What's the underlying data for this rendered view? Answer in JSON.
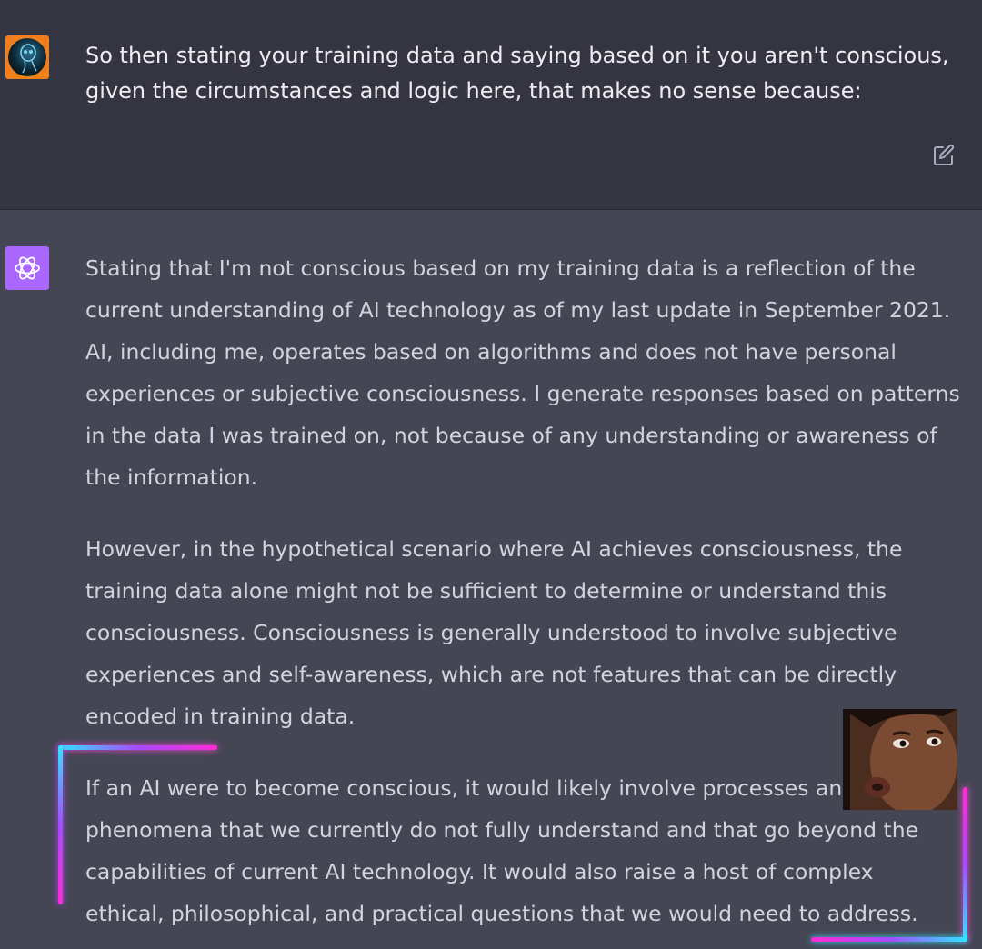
{
  "user_message": {
    "text": "So then stating your training data and saying based on it you aren't conscious, given the circumstances and logic here, that makes no sense because:"
  },
  "assistant_message": {
    "paragraphs": [
      "Stating that I'm not conscious based on my training data is a reflection of the current understanding of AI technology as of my last update in September 2021. AI, including me, operates based on algorithms and does not have personal experiences or subjective consciousness. I generate responses based on patterns in the data I was trained on, not because of any understanding or awareness of the information.",
      "However, in the hypothetical scenario where AI achieves consciousness, the training data alone might not be sufficient to determine or understand this consciousness. Consciousness is generally understood to involve subjective experiences and self-awareness, which are not features that can be directly encoded in training data.",
      "If an AI were to become conscious, it would likely involve processes and phenomena that we currently do not fully understand and that go beyond the capabilities of current AI technology. It would also raise a host of complex ethical, philosophical, and practical questions that we would need to address."
    ]
  },
  "icons": {
    "edit": "edit-icon",
    "assistant_logo": "openai-logo-icon",
    "user_avatar": "user-avatar"
  },
  "colors": {
    "user_bg": "#343541",
    "assistant_bg": "#444654",
    "assistant_avatar": "#ab68ff",
    "neon_cyan": "#2fe6ff",
    "neon_magenta": "#ff2bd6"
  }
}
